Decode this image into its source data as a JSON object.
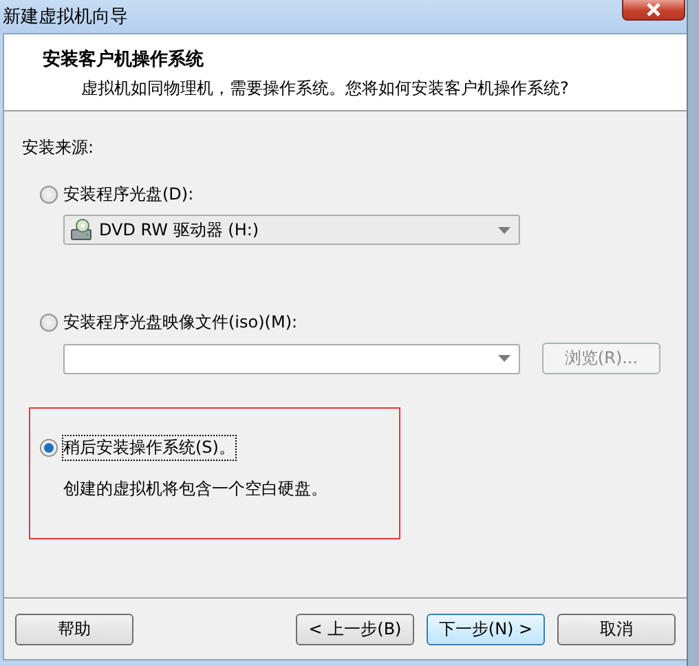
{
  "window": {
    "title": "新建虚拟机向导"
  },
  "header": {
    "title": "安装客户机操作系统",
    "subtitle": "虚拟机如同物理机，需要操作系统。您将如何安装客户机操作系统?"
  },
  "source_label": "安装来源:",
  "options": [
    {
      "label": "安装程序光盘(D):",
      "selected": false,
      "highlighted": false,
      "combo": {
        "value": "DVD RW 驱动器 (H:)",
        "disabled": false
      }
    },
    {
      "label": "安装程序光盘映像文件(iso)(M):",
      "selected": false,
      "highlighted": false,
      "combo": {
        "disabled": true
      },
      "browse": {
        "label": "浏览(R)...",
        "disabled": true
      }
    },
    {
      "label": "稍后安装操作系统(S)。",
      "selected": true,
      "highlighted": true,
      "note": "创建的虚拟机将包含一个空白硬盘。"
    }
  ],
  "help_button": {
    "label": "帮助"
  },
  "buttons": [
    {
      "label": "< 上一步(B)",
      "default": false
    },
    {
      "label": "下一步(N) >",
      "default": true
    },
    {
      "label": "取消",
      "default": false
    }
  ]
}
